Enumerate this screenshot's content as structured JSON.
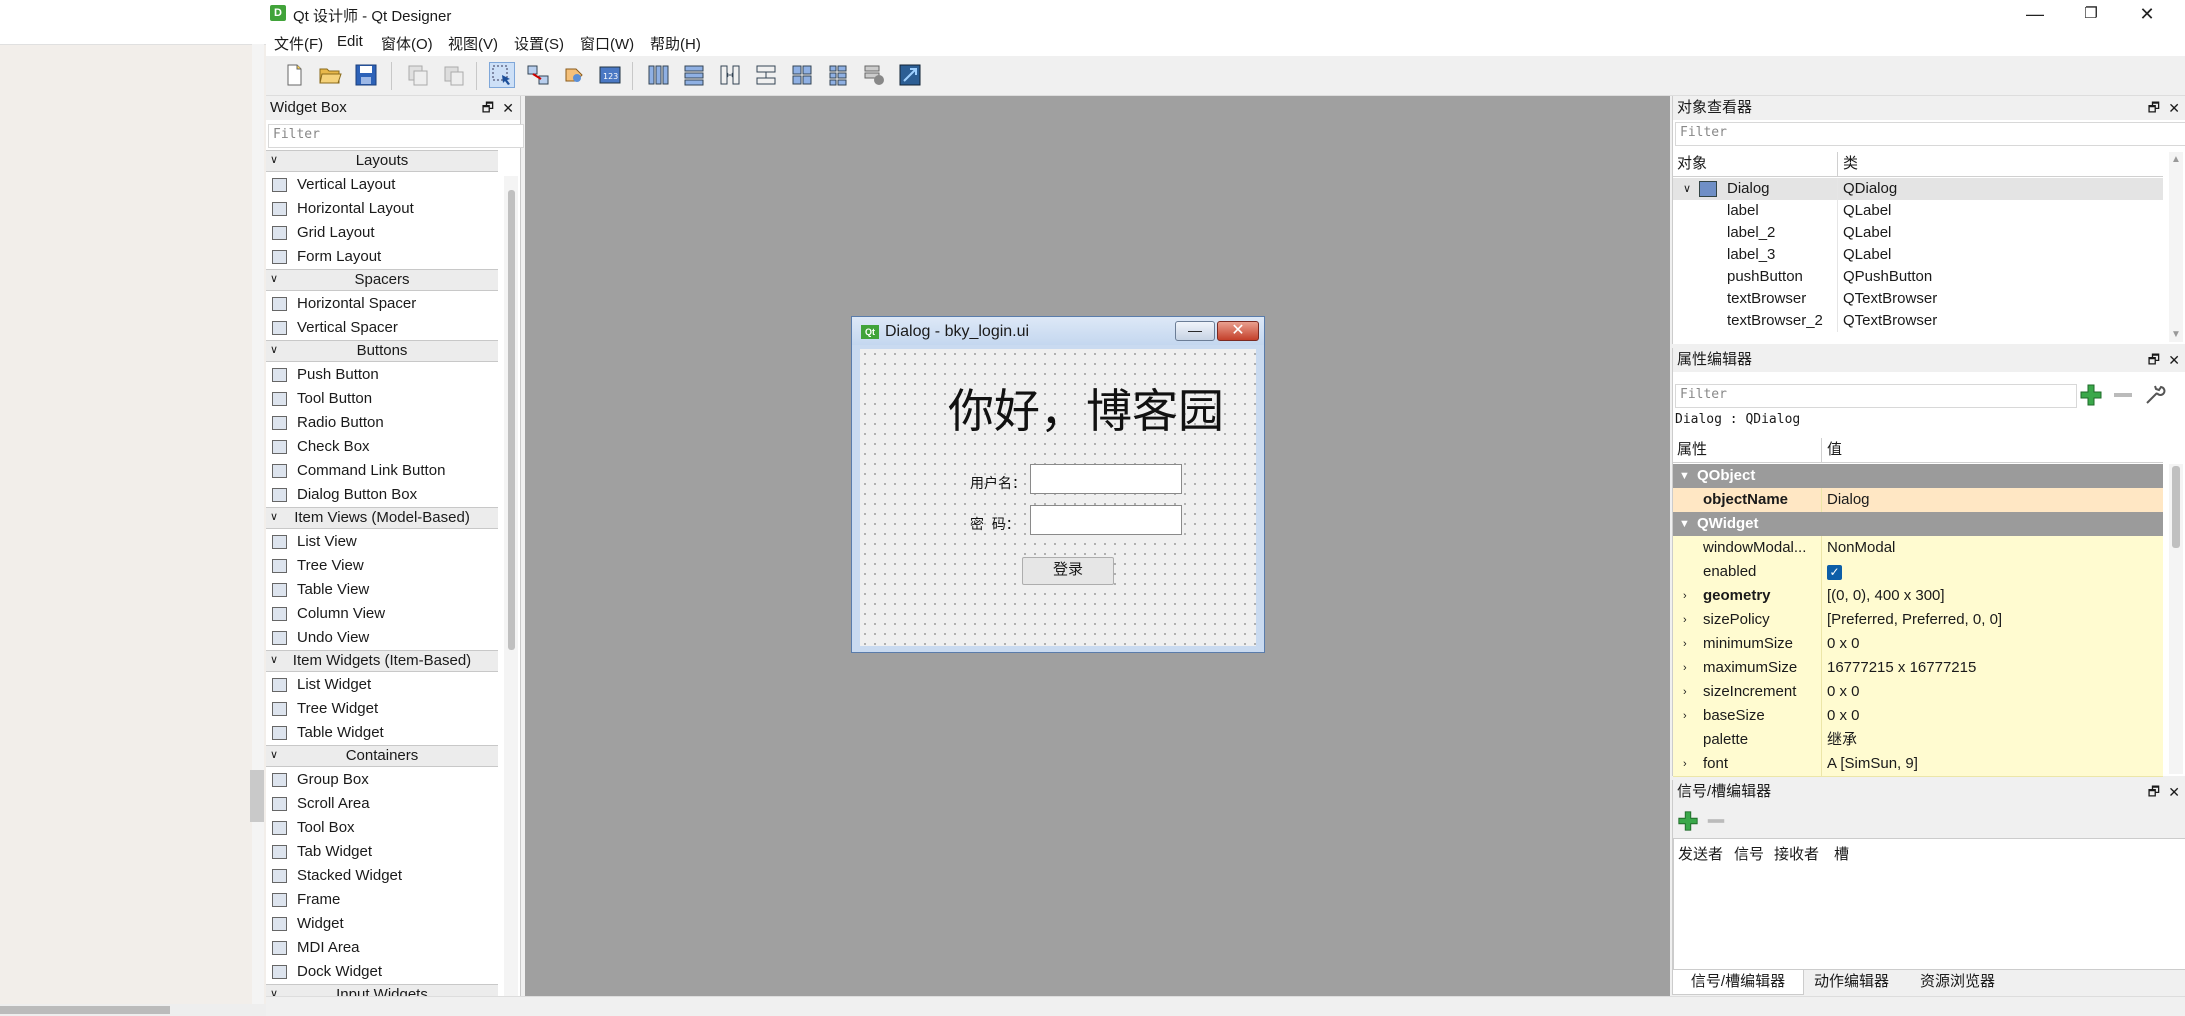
{
  "window": {
    "title": "Qt 设计师 - Qt Designer",
    "app_icon": "D",
    "min": "—",
    "max": "❐",
    "close": "✕"
  },
  "menu": [
    "文件(F)",
    "Edit",
    "窗体(O)",
    "视图(V)",
    "设置(S)",
    "窗口(W)",
    "帮助(H)"
  ],
  "toolbar_icons": [
    "new-file-icon",
    "open-folder-icon",
    "save-icon",
    "copy-icon",
    "paste-icon",
    "edit-widgets-icon",
    "edit-signals-icon",
    "edit-buddies-icon",
    "edit-tab-order-icon",
    "layout-horizontal-icon",
    "layout-vertical-icon",
    "splitter-horizontal-icon",
    "splitter-vertical-icon",
    "layout-grid-icon",
    "layout-form-icon",
    "break-layout-icon",
    "adjust-size-icon"
  ],
  "widget_box": {
    "title": "Widget Box",
    "float": "🗗",
    "close": "✕",
    "filter_placeholder": "Filter",
    "categories": [
      {
        "name": "Layouts",
        "items": [
          "Vertical Layout",
          "Horizontal Layout",
          "Grid Layout",
          "Form Layout"
        ]
      },
      {
        "name": "Spacers",
        "items": [
          "Horizontal Spacer",
          "Vertical Spacer"
        ]
      },
      {
        "name": "Buttons",
        "items": [
          "Push Button",
          "Tool Button",
          "Radio Button",
          "Check Box",
          "Command Link Button",
          "Dialog Button Box"
        ]
      },
      {
        "name": "Item Views (Model-Based)",
        "items": [
          "List View",
          "Tree View",
          "Table View",
          "Column View",
          "Undo View"
        ]
      },
      {
        "name": "Item Widgets (Item-Based)",
        "items": [
          "List Widget",
          "Tree Widget",
          "Table Widget"
        ]
      },
      {
        "name": "Containers",
        "items": [
          "Group Box",
          "Scroll Area",
          "Tool Box",
          "Tab Widget",
          "Stacked Widget",
          "Frame",
          "Widget",
          "MDI Area",
          "Dock Widget"
        ]
      },
      {
        "name": "Input Widgets",
        "items": []
      }
    ]
  },
  "dialog": {
    "title": "Dialog - bky_login.ui",
    "qt_badge": "Qt",
    "min": "—",
    "close": "✕",
    "heading": "你好，博客园",
    "username_label": "用户名：",
    "password_label": "密  码：",
    "login_button": "登录"
  },
  "object_inspector": {
    "title": "对象查看器",
    "filter_placeholder": "Filter",
    "col_object": "对象",
    "col_class": "类",
    "rows": [
      {
        "name": "Dialog",
        "cls": "QDialog"
      },
      {
        "name": "label",
        "cls": "QLabel"
      },
      {
        "name": "label_2",
        "cls": "QLabel"
      },
      {
        "name": "label_3",
        "cls": "QLabel"
      },
      {
        "name": "pushButton",
        "cls": "QPushButton"
      },
      {
        "name": "textBrowser",
        "cls": "QTextBrowser"
      },
      {
        "name": "textBrowser_2",
        "cls": "QTextBrowser"
      }
    ]
  },
  "property_editor": {
    "title": "属性编辑器",
    "filter_placeholder": "Filter",
    "context": "Dialog : QDialog",
    "col_property": "属性",
    "col_value": "值",
    "group_qobject": "QObject",
    "group_qwidget": "QWidget",
    "object_name_key": "objectName",
    "object_name_val": "Dialog",
    "props": [
      {
        "name": "windowModal...",
        "value": "NonModal",
        "bold": false,
        "expand": false
      },
      {
        "name": "enabled",
        "value": "",
        "bold": false,
        "expand": false,
        "checkbox": true
      },
      {
        "name": "geometry",
        "value": "[(0, 0), 400 x 300]",
        "bold": true,
        "expand": true
      },
      {
        "name": "sizePolicy",
        "value": "[Preferred, Preferred, 0, 0]",
        "bold": false,
        "expand": true
      },
      {
        "name": "minimumSize",
        "value": "0 x 0",
        "bold": false,
        "expand": true
      },
      {
        "name": "maximumSize",
        "value": "16777215 x 16777215",
        "bold": false,
        "expand": true
      },
      {
        "name": "sizeIncrement",
        "value": "0 x 0",
        "bold": false,
        "expand": true
      },
      {
        "name": "baseSize",
        "value": "0 x 0",
        "bold": false,
        "expand": true
      },
      {
        "name": "palette",
        "value": "继承",
        "bold": false,
        "expand": false
      },
      {
        "name": "font",
        "value": "A  [SimSun, 9]",
        "bold": false,
        "expand": true
      }
    ]
  },
  "signal_editor": {
    "title": "信号/槽编辑器",
    "cols": [
      "发送者",
      "信号",
      "接收者",
      "槽"
    ]
  },
  "bottom_tabs": [
    "信号/槽编辑器",
    "动作编辑器",
    "资源浏览器"
  ]
}
